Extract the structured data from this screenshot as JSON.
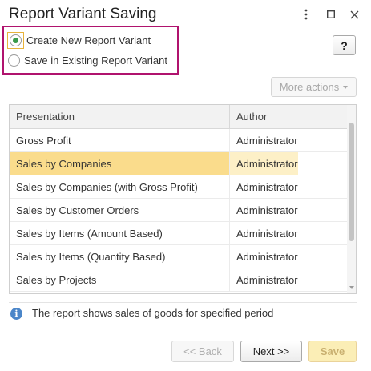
{
  "window": {
    "title": "Report Variant Saving"
  },
  "options": {
    "create_new": "Create New Report Variant",
    "save_existing": "Save in Existing Report Variant",
    "selected": "create_new"
  },
  "toolbar": {
    "help_label": "?",
    "more_actions_label": "More actions"
  },
  "table": {
    "columns": [
      "Presentation",
      "Author"
    ],
    "rows": [
      {
        "presentation": "Gross Profit",
        "author": "Administrator"
      },
      {
        "presentation": "Sales by Companies",
        "author": "Administrator",
        "selected": true
      },
      {
        "presentation": "Sales by Companies (with Gross Profit)",
        "author": "Administrator"
      },
      {
        "presentation": "Sales by Customer Orders",
        "author": "Administrator"
      },
      {
        "presentation": "Sales by Items (Amount Based)",
        "author": "Administrator"
      },
      {
        "presentation": "Sales by Items (Quantity Based)",
        "author": "Administrator"
      },
      {
        "presentation": "Sales by Projects",
        "author": "Administrator"
      }
    ]
  },
  "info": {
    "text": "The report shows sales of goods for specified period"
  },
  "buttons": {
    "back": "<< Back",
    "next": "Next >>",
    "save": "Save"
  },
  "colors": {
    "highlight_border": "#b0136e",
    "selected_row": "#fadc8c",
    "radio_dot": "#3a9a4a",
    "save_button": "#fbeeb6"
  }
}
